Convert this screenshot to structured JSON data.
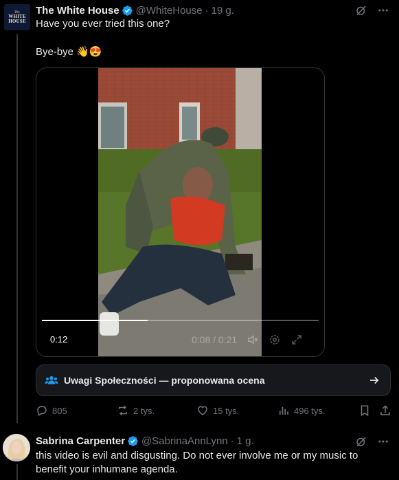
{
  "tweet": {
    "author_name": "The White House",
    "author_handle": "@WhiteHouse",
    "separator": "·",
    "time": "19 g.",
    "text_line1": "Have you ever tried this one?",
    "text_line2": "Bye-bye 👋😍",
    "avatar_text": [
      "The",
      "WHITE",
      "HOUSE"
    ],
    "video": {
      "remaining": "0:12",
      "position": "0:08 / 0:21",
      "progress_fraction": 0.381
    },
    "community_note": {
      "label": "Uwagi Społeczności — proponowana ocena"
    },
    "actions": {
      "replies": "805",
      "reposts": "2 tys.",
      "likes": "15 tys.",
      "views": "496 tys."
    }
  },
  "reply": {
    "author_name": "Sabrina Carpenter",
    "author_handle": "@SabrinaAnnLynn",
    "separator": "·",
    "time": "1 g.",
    "text_line1": "this video is evil and disgusting. Do not ever involve me or my music to",
    "text_line2": "benefit your inhumane agenda."
  },
  "colors": {
    "background": "#000000",
    "text": "#e7e9ea",
    "muted": "#71767b",
    "verified": "#1d9bf0",
    "note_accent": "#1d9bf0"
  },
  "icons": [
    "grok-icon",
    "more-icon",
    "verified-icon",
    "community-notes-icon",
    "arrow-right-icon",
    "reply-icon",
    "repost-icon",
    "like-icon",
    "views-icon",
    "bookmark-icon",
    "share-icon",
    "mute-icon",
    "settings-icon",
    "fullscreen-icon"
  ]
}
